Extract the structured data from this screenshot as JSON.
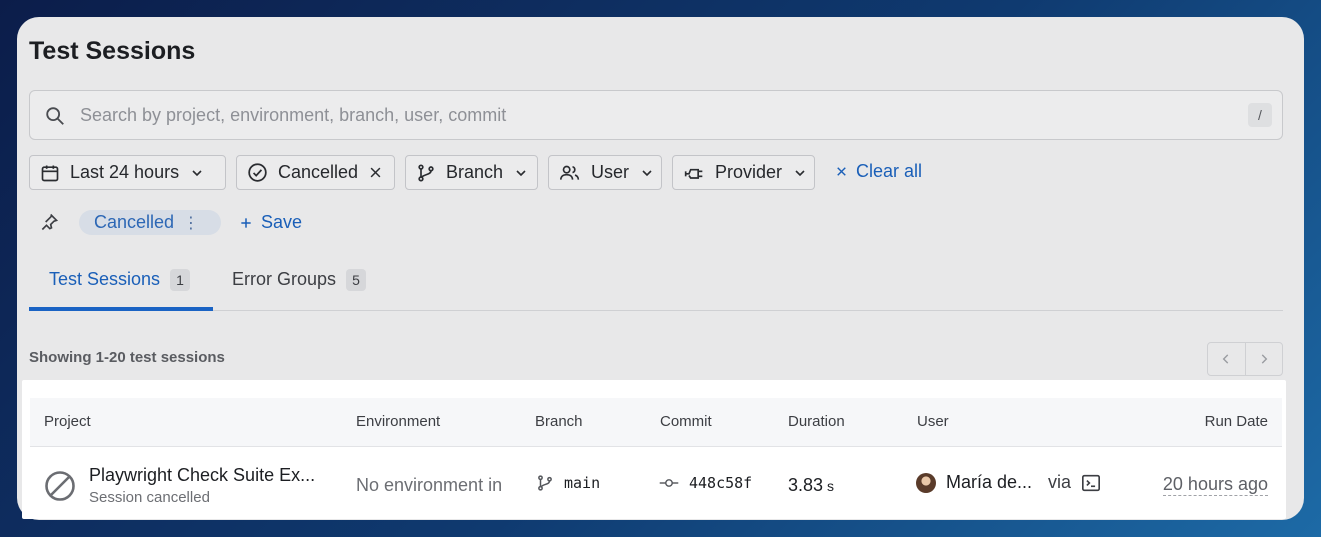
{
  "page": {
    "title": "Test Sessions"
  },
  "search": {
    "placeholder": "Search by project, environment, branch, user, commit",
    "shortcut": "/"
  },
  "filters": [
    {
      "label": "Last 24 hours",
      "icon": "calendar-icon",
      "control": "chevron-down-icon"
    },
    {
      "label": "Cancelled",
      "icon": "check-circle-icon",
      "control": "close-icon"
    },
    {
      "label": "Branch",
      "icon": "git-branch-icon",
      "control": "chevron-down-icon"
    },
    {
      "label": "User",
      "icon": "users-icon",
      "control": "chevron-down-icon"
    },
    {
      "label": "Provider",
      "icon": "provider-plug-icon",
      "control": "chevron-down-icon"
    }
  ],
  "clear_all": "Clear all",
  "saved_view": {
    "label": "Cancelled",
    "more": "⋮"
  },
  "save": "Save",
  "tabs": [
    {
      "label": "Test Sessions",
      "count": "1",
      "active": true
    },
    {
      "label": "Error Groups",
      "count": "5",
      "active": false
    }
  ],
  "showing": "Showing 1-20 test sessions",
  "table": {
    "columns": [
      "Project",
      "Environment",
      "Branch",
      "Commit",
      "Duration",
      "User",
      "Run Date"
    ],
    "rows": [
      {
        "project": "Playwright Check Suite Ex...",
        "status": "Session cancelled",
        "environment": "No environment in",
        "branch": "main",
        "commit": "448c58f",
        "duration_value": "3.83",
        "duration_unit": "s",
        "user": "María de...",
        "via": "via",
        "run_date": "20 hours ago"
      }
    ]
  },
  "colors": {
    "accent": "#1a5fb8",
    "tab_underline": "#1a63c4",
    "panel": "#e8e8e9"
  }
}
